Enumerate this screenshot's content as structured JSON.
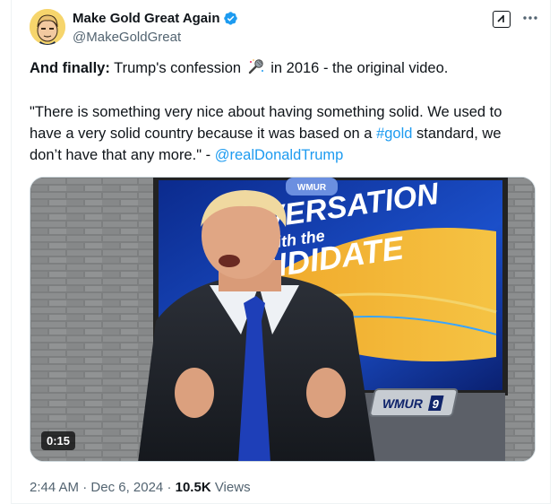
{
  "author": {
    "display_name": "Make Gold Great Again",
    "handle": "@MakeGoldGreat"
  },
  "tweet": {
    "intro_bold": "And finally:",
    "intro_text_a": " Trump's confession ",
    "intro_text_b": " in 2016 - the original video.",
    "quote_a": "\"There is something very nice about having something solid. We used to have a very solid country because it was based on a ",
    "hashtag": "#gold",
    "quote_b": " standard, we don’t have that any more.\" - ",
    "mention": "@realDonaldTrump"
  },
  "video": {
    "duration": "0:15",
    "banner_top": "WMUR",
    "banner_line1": "VERSATION",
    "banner_line2": "with the",
    "banner_line3": "NDIDATE",
    "station_logo": "WMUR",
    "station_channel": "9"
  },
  "meta": {
    "time": "2:44 AM",
    "sep": " · ",
    "date": "Dec 6, 2024",
    "views_count": "10.5K",
    "views_label": " Views"
  },
  "icons": {
    "verified": "verified-badge-icon",
    "grok": "grok-icon",
    "more": "more-icon",
    "emoji": "microphone-icon"
  },
  "colors": {
    "link": "#1d9bf0",
    "secondary": "#536471",
    "primary_text": "#0f1419"
  }
}
